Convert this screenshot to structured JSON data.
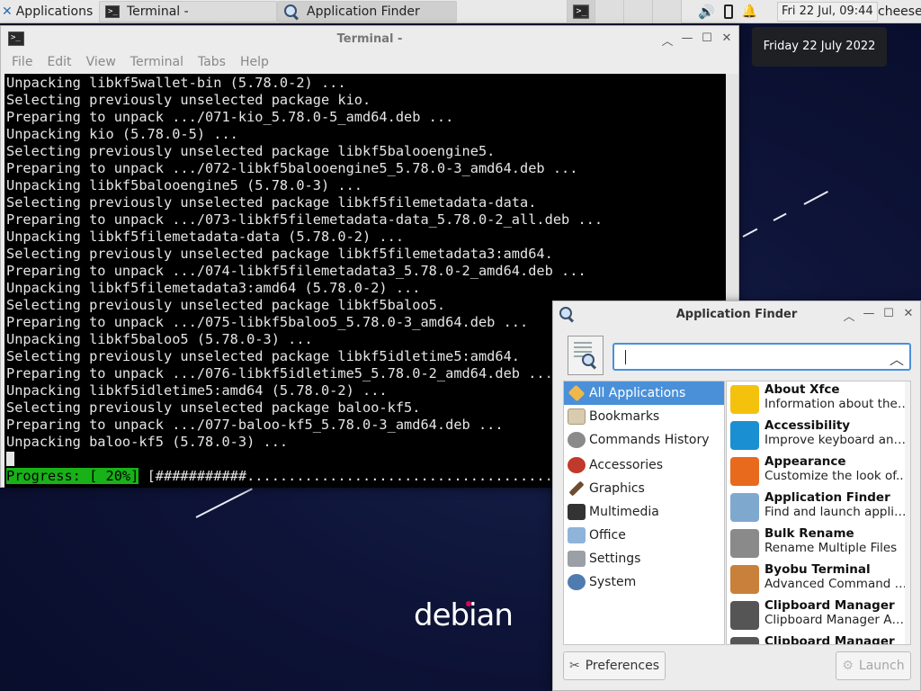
{
  "panel": {
    "applications_label": "Applications",
    "tasks": [
      {
        "label": "Terminal -"
      },
      {
        "label": "Application Finder"
      }
    ],
    "clock": "Fri 22 Jul, 09:44",
    "user": "cheese"
  },
  "notification": {
    "text": "Friday 22 July 2022"
  },
  "terminal": {
    "title": "Terminal -",
    "menu": [
      "File",
      "Edit",
      "View",
      "Terminal",
      "Tabs",
      "Help"
    ],
    "lines": [
      "Unpacking libkf5wallet-bin (5.78.0-2) ...",
      "Selecting previously unselected package kio.",
      "Preparing to unpack .../071-kio_5.78.0-5_amd64.deb ...",
      "Unpacking kio (5.78.0-5) ...",
      "Selecting previously unselected package libkf5balooengine5.",
      "Preparing to unpack .../072-libkf5balooengine5_5.78.0-3_amd64.deb ...",
      "Unpacking libkf5balooengine5 (5.78.0-3) ...",
      "Selecting previously unselected package libkf5filemetadata-data.",
      "Preparing to unpack .../073-libkf5filemetadata-data_5.78.0-2_all.deb ...",
      "Unpacking libkf5filemetadata-data (5.78.0-2) ...",
      "Selecting previously unselected package libkf5filemetadata3:amd64.",
      "Preparing to unpack .../074-libkf5filemetadata3_5.78.0-2_amd64.deb ...",
      "Unpacking libkf5filemetadata3:amd64 (5.78.0-2) ...",
      "Selecting previously unselected package libkf5baloo5.",
      "Preparing to unpack .../075-libkf5baloo5_5.78.0-3_amd64.deb ...",
      "Unpacking libkf5baloo5 (5.78.0-3) ...",
      "Selecting previously unselected package libkf5idletime5:amd64.",
      "Preparing to unpack .../076-libkf5idletime5_5.78.0-2_amd64.deb ...",
      "Unpacking libkf5idletime5:amd64 (5.78.0-2) ...",
      "Selecting previously unselected package baloo-kf5.",
      "Preparing to unpack .../077-baloo-kf5_5.78.0-3_amd64.deb ...",
      "Unpacking baloo-kf5 (5.78.0-3) ..."
    ],
    "progress_label": "Progress: [ 20%]",
    "progress_bar": " [###########.....................................",
    "progress_value": 0.2
  },
  "finder": {
    "title": "Application Finder",
    "search_value": "",
    "categories": [
      {
        "label": "All Applications",
        "selected": true
      },
      {
        "label": "Bookmarks"
      },
      {
        "label": "Commands History"
      },
      {
        "label": "Accessories"
      },
      {
        "label": "Graphics"
      },
      {
        "label": "Multimedia"
      },
      {
        "label": "Office"
      },
      {
        "label": "Settings"
      },
      {
        "label": "System"
      }
    ],
    "apps": [
      {
        "name": "About Xfce",
        "desc": "Information about the ...",
        "color": "#f4c20d"
      },
      {
        "name": "Accessibility",
        "desc": "Improve keyboard and...",
        "color": "#1a8fd1"
      },
      {
        "name": "Appearance",
        "desc": "Customize the look of...",
        "color": "#e86a1c"
      },
      {
        "name": "Application Finder",
        "desc": "Find and launch applic...",
        "color": "#7fa8cf"
      },
      {
        "name": "Bulk Rename",
        "desc": "Rename Multiple Files",
        "color": "#8a8a8a"
      },
      {
        "name": "Byobu Terminal",
        "desc": "Advanced Command L...",
        "color": "#c9803a"
      },
      {
        "name": "Clipboard Manager",
        "desc": "Clipboard Manager Au...",
        "color": "#555555"
      },
      {
        "name": "Clipboard Manager",
        "desc": "",
        "color": "#555555"
      }
    ],
    "preferences_label": "Preferences",
    "launch_label": "Launch"
  },
  "desktop": {
    "logo_text": "debian"
  },
  "colors": {
    "accent": "#4a90d9",
    "progress_green": "#18b218",
    "debian_red": "#d70751"
  }
}
